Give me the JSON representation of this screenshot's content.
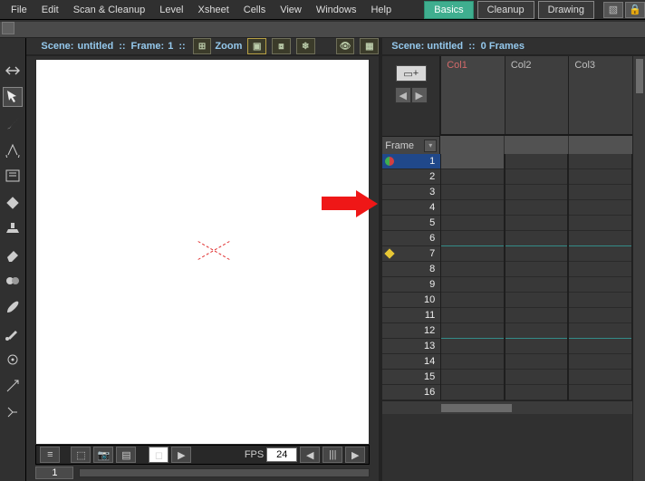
{
  "menu": {
    "file": "File",
    "edit": "Edit",
    "scan": "Scan & Cleanup",
    "level": "Level",
    "xsheet": "Xsheet",
    "cells": "Cells",
    "view": "View",
    "windows": "Windows",
    "help": "Help"
  },
  "tabs": {
    "basics": "Basics",
    "cleanup": "Cleanup",
    "drawing": "Drawing"
  },
  "viewer": {
    "scene_label": "Scene:",
    "scene_name": "untitled",
    "sep": "::",
    "frame_label": "Frame:",
    "frame_value": "1",
    "zoom_label": "Zoom",
    "fps_label": "FPS",
    "fps_value": "24",
    "current_frame": "1"
  },
  "xsheet": {
    "title_scene_label": "Scene:",
    "title_scene_name": "untitled",
    "title_sep": "::",
    "title_frames": "0 Frames",
    "cols": [
      "Col1",
      "Col2",
      "Col3"
    ],
    "frame_header": "Frame",
    "add_btn": "+",
    "rows": [
      "1",
      "2",
      "3",
      "4",
      "5",
      "6",
      "7",
      "8",
      "9",
      "10",
      "11",
      "12",
      "13",
      "14",
      "15",
      "16"
    ],
    "selected_row": 0,
    "marker_rows": {
      "0": "redgreen",
      "6": "yellow"
    }
  }
}
